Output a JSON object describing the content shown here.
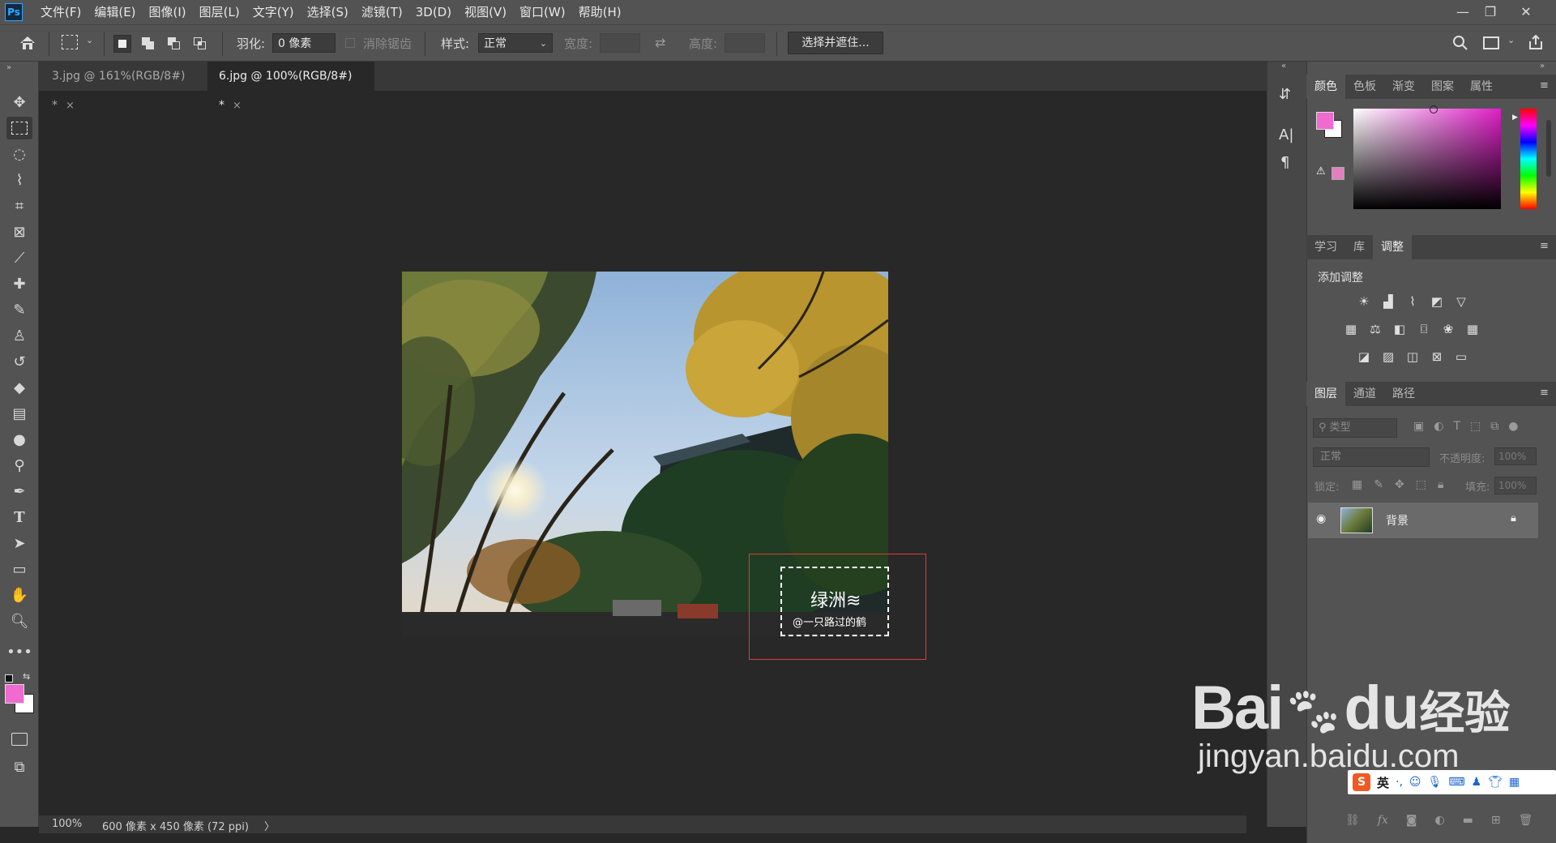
{
  "menubar": {
    "logo": "Ps",
    "items": [
      "文件(F)",
      "编辑(E)",
      "图像(I)",
      "图层(L)",
      "文字(Y)",
      "选择(S)",
      "滤镜(T)",
      "3D(D)",
      "视图(V)",
      "窗口(W)",
      "帮助(H)"
    ],
    "window_controls": [
      "—",
      "❐",
      "✕"
    ]
  },
  "options": {
    "feather_label": "羽化:",
    "feather_value": "0 像素",
    "antialias_label": "消除锯齿",
    "style_label": "样式:",
    "style_value": "正常",
    "width_label": "宽度:",
    "height_label": "高度:",
    "select_mask_button": "选择并遮住..."
  },
  "tabs": [
    {
      "label": "3.jpg @ 161%(RGB/8#) *",
      "close": "×"
    },
    {
      "label": "6.jpg @ 100%(RGB/8#) *",
      "close": "×"
    }
  ],
  "canvas": {
    "watermark_title": "绿洲≋",
    "watermark_sub": "@一只路过的鹤"
  },
  "status": {
    "zoom": "100%",
    "doc_info": "600 像素 x 450 像素 (72 ppi)",
    "arrow": "〉"
  },
  "color_panel": {
    "tabs": [
      "颜色",
      "色板",
      "渐变",
      "图案",
      "属性"
    ],
    "foreground": "#f06ad0",
    "background": "#ffffff"
  },
  "adjust_panel": {
    "tabs": [
      "学习",
      "库",
      "调整"
    ],
    "heading": "添加调整"
  },
  "layers_panel": {
    "tabs": [
      "图层",
      "通道",
      "路径"
    ],
    "filter_label": "类型",
    "blend_mode": "正常",
    "opacity_label": "不透明度:",
    "opacity_value": "100%",
    "lock_label": "锁定:",
    "fill_label": "填充:",
    "fill_value": "100%",
    "layer_name": "背景"
  },
  "watermark": {
    "brand": "Bai",
    "brand2": "du",
    "cn": "经验",
    "url": "jingyan.baidu.com"
  },
  "ime": {
    "label": "英"
  }
}
